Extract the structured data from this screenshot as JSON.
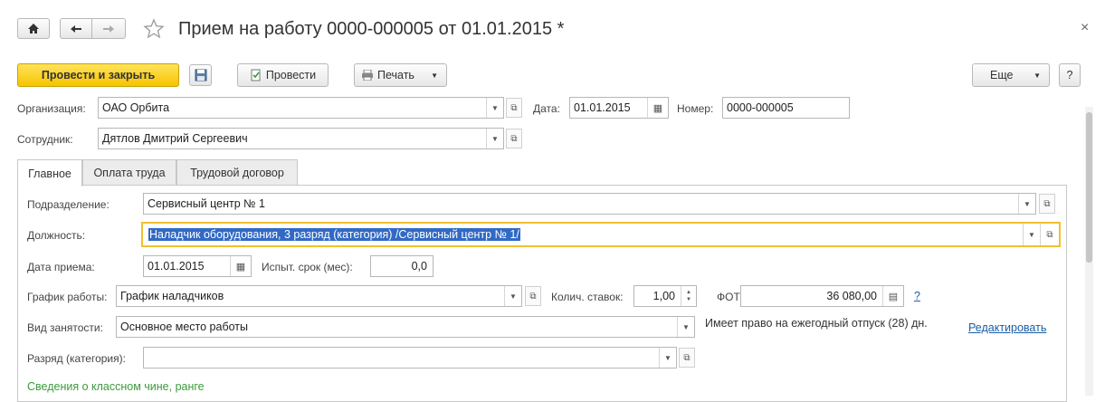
{
  "header": {
    "home_icon": "home-icon",
    "back_icon": "back-arrow-icon",
    "forward_icon": "forward-arrow-icon",
    "star_icon": "star-icon",
    "title": "Прием на работу 0000-000005 от 01.01.2015 *",
    "close_glyph": "×"
  },
  "toolbar": {
    "post_close": "Провести и закрыть",
    "save_icon": "floppy-icon",
    "post": "Провести",
    "print": "Печать",
    "more": "Еще",
    "help": "?"
  },
  "form": {
    "org_label": "Организация:",
    "org_value": "ОАО Орбита",
    "date_label": "Дата:",
    "date_value": "01.01.2015",
    "number_label": "Номер:",
    "number_value": "0000-000005",
    "employee_label": "Сотрудник:",
    "employee_value": "Дятлов Дмитрий Сергеевич"
  },
  "tabs": [
    {
      "label": "Главное",
      "active": true
    },
    {
      "label": "Оплата труда",
      "active": false
    },
    {
      "label": "Трудовой договор",
      "active": false
    }
  ],
  "main": {
    "dept_label": "Подразделение:",
    "dept_value": "Сервисный центр № 1",
    "position_label": "Должность:",
    "position_value": "Наладчик оборудования, 3 разряд (категория) /Сервисный центр № 1/",
    "hire_date_label": "Дата приема:",
    "hire_date_value": "01.01.2015",
    "probation_label": "Испыт. срок (мес):",
    "probation_value": "0,0",
    "schedule_label": "График работы:",
    "schedule_value": "График наладчиков",
    "rates_label": "Колич. ставок:",
    "rates_value": "1,00",
    "payroll_label": "ФОТ:",
    "payroll_value": "36 080,00",
    "payroll_help": "?",
    "employment_label": "Вид занятости:",
    "employment_value": "Основное место работы",
    "vacation_text": "Имеет право на ежегодный отпуск (28) дн.",
    "edit_link": "Редактировать",
    "grade_label": "Разряд (категория):",
    "grade_value": "",
    "class_rank_partial": "Сведения о классном чине, ранге"
  }
}
